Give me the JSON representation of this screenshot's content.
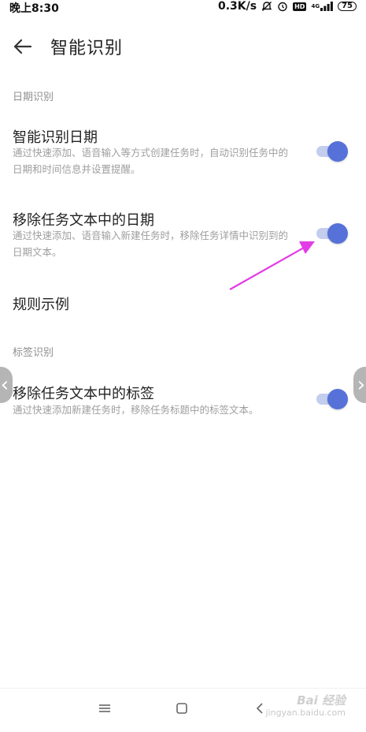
{
  "status_bar": {
    "time": "晚上8:30",
    "speed": "0.3K/s",
    "hd": "HD",
    "network": "4G",
    "battery": "75"
  },
  "header": {
    "title": "智能识别"
  },
  "sections": [
    {
      "label": "日期识别",
      "items": [
        {
          "title": "智能识别日期",
          "desc": "通过快速添加、语音输入等方式创建任务时，自动识别任务中的日期和时间信息并设置提醒。",
          "enabled": true
        },
        {
          "title": "移除任务文本中的日期",
          "desc": "通过快速添加、语音输入新建任务时，移除任务详情中识别到的日期文本。",
          "enabled": true
        }
      ],
      "link": {
        "title": "规则示例"
      }
    },
    {
      "label": "标签识别",
      "items": [
        {
          "title": "移除任务文本中的标签",
          "desc": "通过快速添加新建任务时，移除任务标题中的标签文本。",
          "enabled": true
        }
      ]
    }
  ],
  "side_nav": {
    "left": "‹",
    "right": "›"
  },
  "watermark": {
    "logo": "Bai 经验",
    "url": "jingyan.baidu.com"
  },
  "colors": {
    "accent": "#5671d8",
    "track": "#c3cdee",
    "annotation": "#e23ce6",
    "secondary_text": "#9e9e9e"
  },
  "icons": {
    "back": "arrow-left-icon",
    "menu": "hamburger-icon",
    "home": "square-icon",
    "nav_back": "chevron-left-icon"
  }
}
